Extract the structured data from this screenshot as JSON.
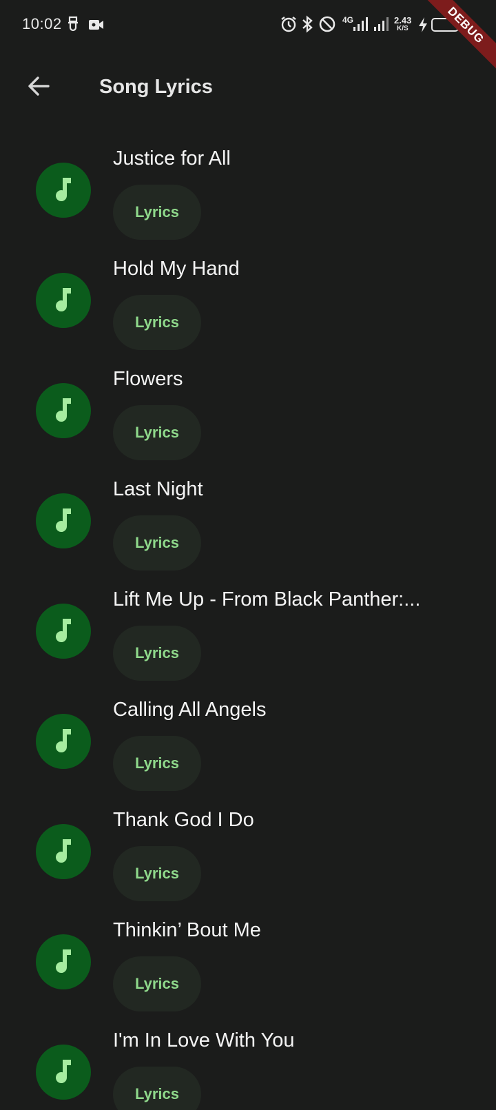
{
  "status_bar": {
    "time": "10:02",
    "network_type": "4G",
    "speed_value": "2.43",
    "speed_unit": "K/S"
  },
  "debug_banner": "DEBUG",
  "app_bar": {
    "title": "Song Lyrics",
    "back_icon": "arrow-back-icon"
  },
  "theme": {
    "background": "#1b1c1b",
    "avatar": "#0b5c1c",
    "note_icon": "#a6eca0",
    "chip_background": "#222822",
    "chip_text": "#8fd98b"
  },
  "songs": [
    {
      "title": "Justice for All",
      "button": "Lyrics"
    },
    {
      "title": "Hold My Hand",
      "button": "Lyrics"
    },
    {
      "title": "Flowers",
      "button": "Lyrics"
    },
    {
      "title": "Last Night",
      "button": "Lyrics"
    },
    {
      "title": "Lift Me Up - From Black Panther:...",
      "button": "Lyrics"
    },
    {
      "title": "Calling All Angels",
      "button": "Lyrics"
    },
    {
      "title": "Thank God I Do",
      "button": "Lyrics"
    },
    {
      "title": "Thinkin’ Bout Me",
      "button": "Lyrics"
    },
    {
      "title": "I'm In Love With You",
      "button": "Lyrics"
    }
  ]
}
